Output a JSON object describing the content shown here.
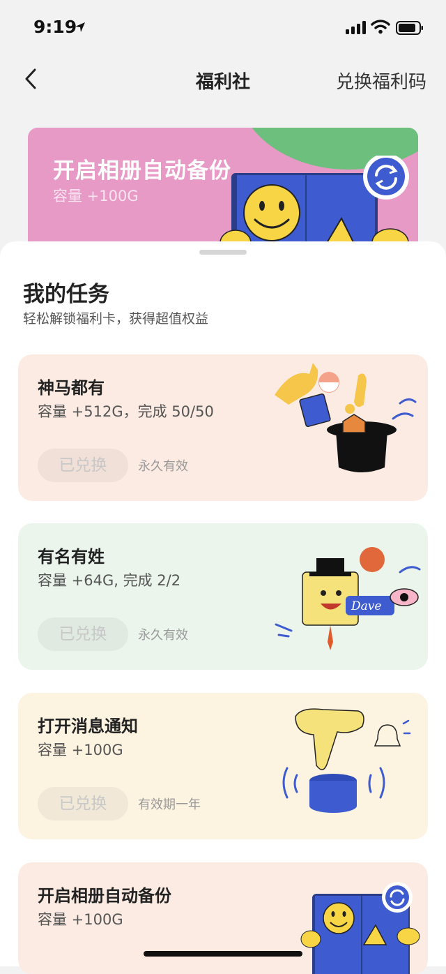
{
  "status": {
    "time": "9:19"
  },
  "nav": {
    "title": "福利社",
    "action": "兑换福利码"
  },
  "banner": {
    "title": "开启相册自动备份",
    "subtitle": "容量 +100G"
  },
  "sheet": {
    "title": "我的任务",
    "subtitle": "轻松解锁福利卡，获得超值权益"
  },
  "tasks": [
    {
      "title": "神马都有",
      "reward": "容量 +512G，完成 50/50",
      "button": "已兑换",
      "validity": "永久有效",
      "bg": "#fcebe2"
    },
    {
      "title": "有名有姓",
      "reward": "容量 +64G, 完成 2/2",
      "button": "已兑换",
      "validity": "永久有效",
      "bg": "#ebf5ec",
      "art_label": "Dave"
    },
    {
      "title": "打开消息通知",
      "reward": "容量 +100G",
      "button": "已兑换",
      "validity": "有效期一年",
      "bg": "#fcf3e1"
    },
    {
      "title": "开启相册自动备份",
      "reward": "容量 +100G",
      "bg": "#fcebe2"
    }
  ]
}
